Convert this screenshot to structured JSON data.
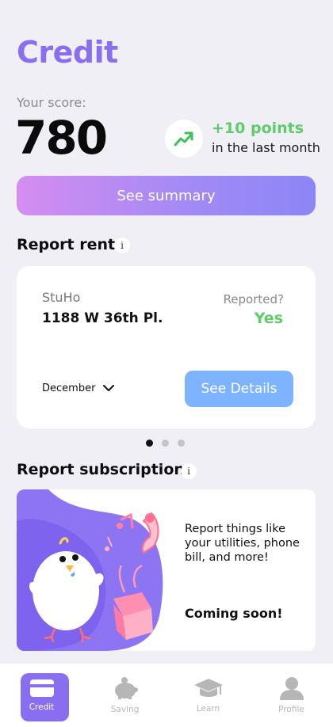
{
  "header": {
    "title": "Credit"
  },
  "score": {
    "label": "Your score:",
    "value": "780",
    "trend_points": "+10 points",
    "trend_period": "in the last month"
  },
  "summary_button": {
    "label": "See summary"
  },
  "report_rent": {
    "title": "Report rent",
    "info_icon": "i",
    "card": {
      "company": "StuHo",
      "address": "1188 W 36th Pl.",
      "reported_label": "Reported?",
      "reported_value": "Yes",
      "month": "December",
      "details_button": "See Details"
    },
    "pagination": {
      "pages": 3,
      "active_index": 0
    }
  },
  "report_subscriptions": {
    "title": "Report subscriptions",
    "info_icon": "i",
    "description": "Report things like your utilities, phone bill, and more!",
    "status": "Coming soon!"
  },
  "nav": {
    "items": [
      {
        "label": "Credit",
        "icon": "card-icon",
        "active": true
      },
      {
        "label": "Saving",
        "icon": "piggy-bank-icon",
        "active": false
      },
      {
        "label": "Learn",
        "icon": "graduation-cap-icon",
        "active": false
      },
      {
        "label": "Profile",
        "icon": "person-icon",
        "active": false
      }
    ]
  },
  "colors": {
    "accent": "#8a6ef0",
    "positive": "#5fcb6a",
    "details_button": "#7eb4ff",
    "background": "#efeff5"
  }
}
